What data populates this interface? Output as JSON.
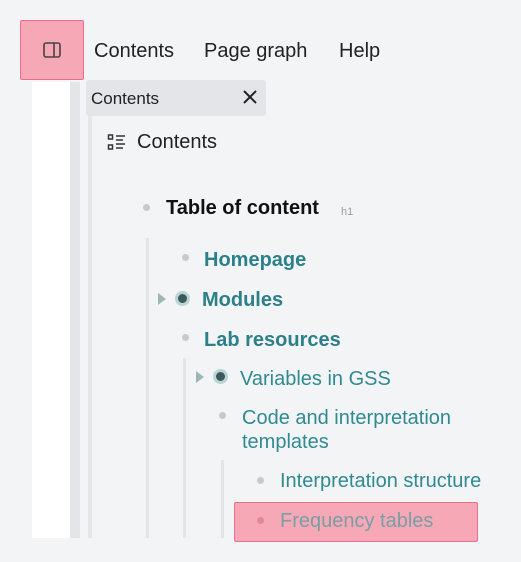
{
  "menubar": {
    "items": [
      "Contents",
      "Page graph",
      "Help"
    ]
  },
  "tab": {
    "label": "Contents"
  },
  "panel": {
    "title": "Contents"
  },
  "toc": {
    "heading": "Table of content",
    "heading_tag": "h1",
    "items": [
      "Homepage",
      "Modules",
      "Lab resources",
      "Variables in GSS",
      "Code and interpretation",
      "templates",
      "Interpretation structure",
      "Frequency tables"
    ]
  },
  "colors": {
    "link": "#2f8a92",
    "highlight": "#f7a8b6",
    "highlight_border": "#ec6f8a"
  },
  "icons": {
    "sidebar_toggle": "sidebar-panel-icon",
    "close": "close-icon",
    "contents": "list-outline-icon"
  }
}
